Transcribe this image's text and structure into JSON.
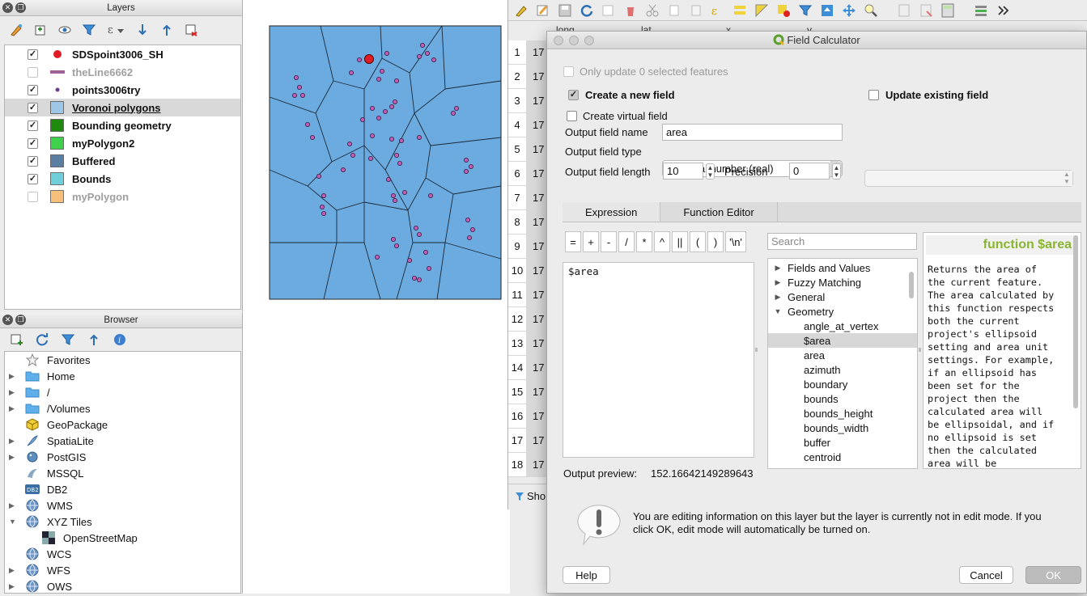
{
  "layers_panel": {
    "title": "Layers",
    "layers": [
      {
        "name": "SDSpoint3006_SH",
        "checked": true,
        "symbol": "circle-red",
        "color": "#e01b24",
        "dim": false,
        "selected": false,
        "underline": false
      },
      {
        "name": "theLine6662",
        "checked": false,
        "symbol": "line",
        "color": "#a05f96",
        "dim": true,
        "selected": false,
        "underline": false
      },
      {
        "name": "points3006try",
        "checked": true,
        "symbol": "dot",
        "color": "#6a3d8f",
        "dim": false,
        "selected": false,
        "underline": false
      },
      {
        "name": "Voronoi polygons",
        "checked": true,
        "symbol": "square",
        "color": "#9ec6e6",
        "dim": false,
        "selected": true,
        "underline": true
      },
      {
        "name": "Bounding geometry",
        "checked": true,
        "symbol": "square",
        "color": "#1f8a0e",
        "dim": false,
        "selected": false,
        "underline": false
      },
      {
        "name": "myPolygon2",
        "checked": true,
        "symbol": "square",
        "color": "#3fd04c",
        "dim": false,
        "selected": false,
        "underline": false
      },
      {
        "name": "Buffered",
        "checked": true,
        "symbol": "square",
        "color": "#5a7fa3",
        "dim": false,
        "selected": false,
        "underline": false
      },
      {
        "name": "Bounds",
        "checked": true,
        "symbol": "square",
        "color": "#6fd0dc",
        "dim": false,
        "selected": false,
        "underline": false
      },
      {
        "name": "myPolygon",
        "checked": false,
        "symbol": "square",
        "color": "#f7c07a",
        "dim": true,
        "selected": false,
        "underline": false
      }
    ]
  },
  "browser_panel": {
    "title": "Browser",
    "items": [
      {
        "label": "Favorites",
        "expander": "",
        "icon": "star-icon",
        "indent": false
      },
      {
        "label": "Home",
        "expander": "▶",
        "icon": "folder-icon",
        "indent": false
      },
      {
        "label": "/",
        "expander": "▶",
        "icon": "folder-icon",
        "indent": false
      },
      {
        "label": "/Volumes",
        "expander": "▶",
        "icon": "folder-icon",
        "indent": false
      },
      {
        "label": "GeoPackage",
        "expander": "",
        "icon": "geopackage-icon",
        "indent": false
      },
      {
        "label": "SpatiaLite",
        "expander": "▶",
        "icon": "spatialite-icon",
        "indent": false
      },
      {
        "label": "PostGIS",
        "expander": "▶",
        "icon": "postgis-icon",
        "indent": false
      },
      {
        "label": "MSSQL",
        "expander": "",
        "icon": "mssql-icon",
        "indent": false
      },
      {
        "label": "DB2",
        "expander": "",
        "icon": "db2-icon",
        "indent": false
      },
      {
        "label": "WMS",
        "expander": "▶",
        "icon": "globe-icon",
        "indent": false
      },
      {
        "label": "XYZ Tiles",
        "expander": "▼",
        "icon": "globe-icon",
        "indent": false
      },
      {
        "label": "OpenStreetMap",
        "expander": "",
        "icon": "tiles-icon",
        "indent": true
      },
      {
        "label": "WCS",
        "expander": "",
        "icon": "globe-icon",
        "indent": false
      },
      {
        "label": "WFS",
        "expander": "▶",
        "icon": "globe-icon",
        "indent": false
      },
      {
        "label": "OWS",
        "expander": "▶",
        "icon": "globe-icon",
        "indent": false
      }
    ]
  },
  "attribute_table": {
    "headers": [
      "long",
      "lat",
      "x",
      "y"
    ],
    "row_numbers": [
      "1",
      "2",
      "3",
      "4",
      "5",
      "6",
      "7",
      "8",
      "9",
      "10",
      "11",
      "12",
      "13",
      "14",
      "15",
      "16",
      "17",
      "18"
    ],
    "first_col_value": "17",
    "show_label": "Sho"
  },
  "field_calculator": {
    "title": "Field Calculator",
    "only_update_selected": "Only update 0 selected features",
    "create_new_field": "Create a new field",
    "create_new_field_checked": true,
    "update_existing": "Update existing field",
    "create_virtual": "Create virtual field",
    "output_name_label": "Output field name",
    "output_name_value": "area",
    "output_type_label": "Output field type",
    "output_type_value": "Decimal number (real)",
    "output_length_label": "Output field length",
    "output_length_value": "10",
    "precision_label": "Precision",
    "precision_value": "0",
    "tabs": [
      "Expression",
      "Function Editor"
    ],
    "operators": [
      "=",
      "+",
      "-",
      "/",
      "*",
      "^",
      "||",
      "(",
      ")",
      "'\\n'"
    ],
    "expression": "$area",
    "search_placeholder": "Search",
    "function_tree": [
      {
        "label": "Fields and Values",
        "expander": "▶",
        "child": false,
        "selected": false
      },
      {
        "label": "Fuzzy Matching",
        "expander": "▶",
        "child": false,
        "selected": false
      },
      {
        "label": "General",
        "expander": "▶",
        "child": false,
        "selected": false
      },
      {
        "label": "Geometry",
        "expander": "▼",
        "child": false,
        "selected": false
      },
      {
        "label": "angle_at_vertex",
        "expander": "",
        "child": true,
        "selected": false
      },
      {
        "label": "$area",
        "expander": "",
        "child": true,
        "selected": true
      },
      {
        "label": "area",
        "expander": "",
        "child": true,
        "selected": false
      },
      {
        "label": "azimuth",
        "expander": "",
        "child": true,
        "selected": false
      },
      {
        "label": "boundary",
        "expander": "",
        "child": true,
        "selected": false
      },
      {
        "label": "bounds",
        "expander": "",
        "child": true,
        "selected": false
      },
      {
        "label": "bounds_height",
        "expander": "",
        "child": true,
        "selected": false
      },
      {
        "label": "bounds_width",
        "expander": "",
        "child": true,
        "selected": false
      },
      {
        "label": "buffer",
        "expander": "",
        "child": true,
        "selected": false
      },
      {
        "label": "centroid",
        "expander": "",
        "child": true,
        "selected": false
      }
    ],
    "help_title": "function $area",
    "help_text": "Returns the area of the current feature. The area calculated by this function respects both the current project's ellipsoid setting and area unit settings. For example, if an ellipsoid has been set for the project then the calculated area will be ellipsoidal, and if no ellipsoid is set then the calculated area will be planimetric.",
    "output_preview_label": "Output preview:",
    "output_preview_value": "152.16642149289643",
    "warning_text": "You are editing information on this layer but the layer is currently not in edit mode. If you click OK, edit mode will automatically be turned on.",
    "help_button": "Help",
    "cancel_button": "Cancel",
    "ok_button": "OK"
  },
  "colors": {
    "voronoi_fill": "#6cabdf",
    "point_fill": "#c35fb6",
    "highlight_point": "#e01b24",
    "help_title_green": "#8ab530"
  }
}
